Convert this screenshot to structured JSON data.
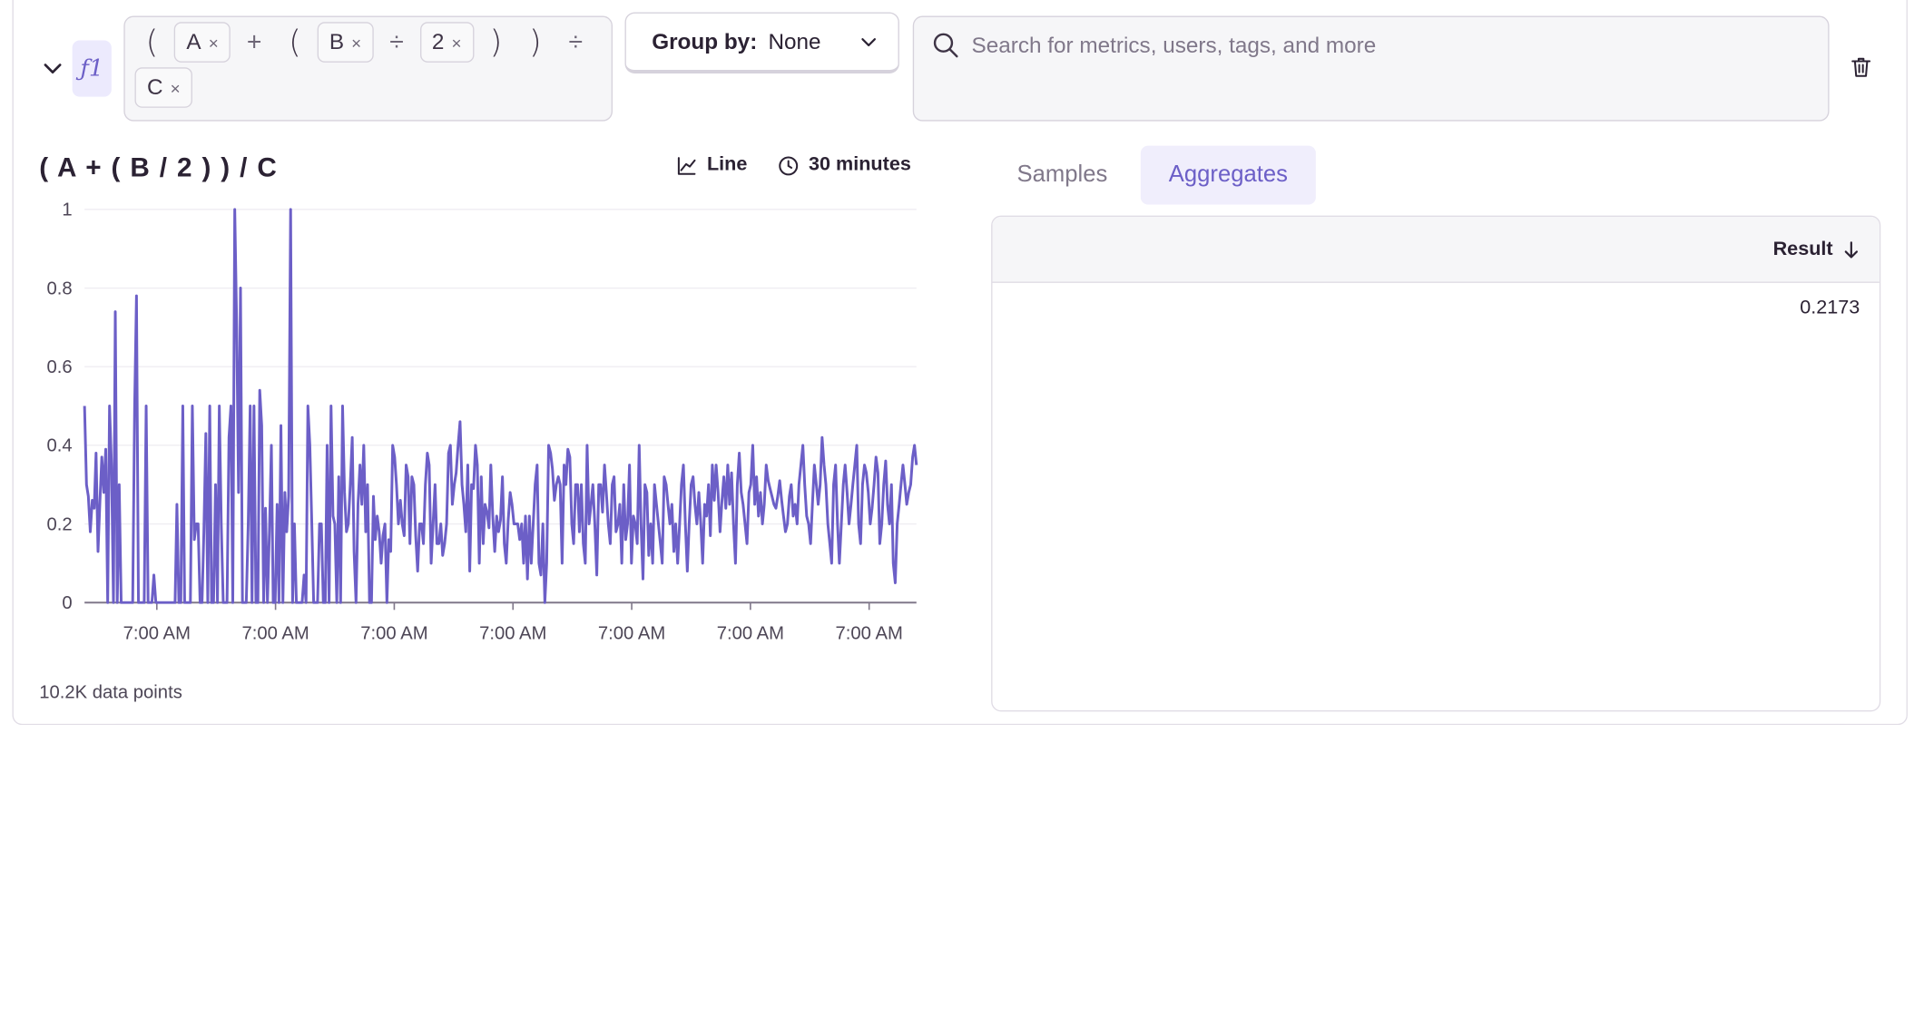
{
  "formula": {
    "label": "ƒ1",
    "tokens": [
      {
        "kind": "paren",
        "text": "("
      },
      {
        "kind": "pill",
        "text": "A"
      },
      {
        "kind": "op",
        "text": "+"
      },
      {
        "kind": "paren",
        "text": "("
      },
      {
        "kind": "pill",
        "text": "B"
      },
      {
        "kind": "op",
        "text": "÷"
      },
      {
        "kind": "pill",
        "text": "2"
      },
      {
        "kind": "paren",
        "text": ")"
      },
      {
        "kind": "paren",
        "text": ")"
      },
      {
        "kind": "op",
        "text": "÷"
      },
      {
        "kind": "pill",
        "text": "C"
      }
    ],
    "remove_glyph": "×"
  },
  "group_by": {
    "label": "Group by:",
    "value": "None"
  },
  "search": {
    "placeholder": "Search for metrics, users, tags, and more"
  },
  "widget": {
    "title": "( A + ( B / 2 ) ) / C",
    "display_type": "Line",
    "interval": "30 minutes",
    "footer": "10.2K data points"
  },
  "tabs": [
    "Samples",
    "Aggregates"
  ],
  "active_tab": "Aggregates",
  "results": {
    "column": "Result",
    "rows": [
      "0.2173"
    ]
  },
  "icons": {
    "collapse": "chevron-down-icon",
    "group_by_dropdown": "chevron-down-icon",
    "search": "search-icon",
    "delete": "trash-icon",
    "line": "line-chart-icon",
    "interval": "clock-icon",
    "sort": "arrow-down-icon"
  },
  "colors": {
    "series": "#6c5fc7",
    "accent": "#6c5fc7"
  },
  "chart_data": {
    "type": "line",
    "title": "( A + ( B / 2 ) ) / C",
    "ylim": [
      0,
      1
    ],
    "yticks": [
      "0",
      "0.2",
      "0.4",
      "0.6",
      "0.8",
      "1"
    ],
    "xticks": [
      "7:00 AM",
      "7:00 AM",
      "7:00 AM",
      "7:00 AM",
      "7:00 AM",
      "7:00 AM",
      "7:00 AM"
    ],
    "grid": true,
    "series": [
      {
        "values": [
          0.5,
          0.3,
          0.27,
          0.18,
          0.26,
          0.24,
          0.38,
          0.13,
          0.26,
          0.37,
          0.28,
          0.39,
          0.0,
          0.5,
          0.35,
          0.0,
          0.74,
          0.0,
          0.3,
          0.0,
          0.0,
          0.0,
          0.0,
          0.0,
          0.0,
          0.0,
          0.5,
          0.78,
          0.0,
          0.0,
          0.0,
          0.0,
          0.5,
          0.0,
          0.0,
          0.0,
          0.07,
          0.0,
          0.0,
          0.0,
          0.0,
          0.0,
          0.0,
          0.0,
          0.0,
          0.0,
          0.0,
          0.0,
          0.25,
          0.0,
          0.0,
          0.5,
          0.0,
          0.0,
          0.0,
          0.0,
          0.5,
          0.16,
          0.2,
          0.2,
          0.0,
          0.0,
          0.18,
          0.43,
          0.0,
          0.5,
          0.0,
          0.0,
          0.3,
          0.0,
          0.5,
          0.2,
          0.0,
          0.0,
          0.0,
          0.42,
          0.5,
          0.0,
          1.0,
          0.7,
          0.28,
          0.8,
          0.0,
          0.0,
          0.0,
          0.2,
          0.5,
          0.0,
          0.5,
          0.0,
          0.0,
          0.54,
          0.45,
          0.0,
          0.24,
          0.0,
          0.18,
          0.4,
          0.0,
          0.0,
          0.25,
          0.0,
          0.45,
          0.0,
          0.28,
          0.18,
          0.27,
          1.0,
          0.0,
          0.2,
          0.0,
          0.0,
          0.0,
          0.0,
          0.07,
          0.0,
          0.5,
          0.4,
          0.2,
          0.0,
          0.0,
          0.0,
          0.2,
          0.2,
          0.0,
          0.0,
          0.4,
          0.0,
          0.5,
          0.22,
          0.2,
          0.0,
          0.32,
          0.0,
          0.5,
          0.28,
          0.18,
          0.2,
          0.3,
          0.42,
          0.13,
          0.0,
          0.25,
          0.35,
          0.25,
          0.4,
          0.18,
          0.3,
          0.0,
          0.0,
          0.27,
          0.16,
          0.22,
          0.18,
          0.1,
          0.17,
          0.2,
          0.0,
          0.16,
          0.13,
          0.4,
          0.37,
          0.3,
          0.2,
          0.26,
          0.2,
          0.17,
          0.35,
          0.32,
          0.15,
          0.32,
          0.3,
          0.17,
          0.08,
          0.2,
          0.2,
          0.15,
          0.3,
          0.38,
          0.35,
          0.1,
          0.2,
          0.3,
          0.15,
          0.15,
          0.2,
          0.12,
          0.15,
          0.2,
          0.38,
          0.4,
          0.25,
          0.3,
          0.33,
          0.4,
          0.46,
          0.3,
          0.25,
          0.18,
          0.35,
          0.08,
          0.3,
          0.29,
          0.4,
          0.35,
          0.1,
          0.32,
          0.15,
          0.25,
          0.23,
          0.19,
          0.35,
          0.22,
          0.13,
          0.22,
          0.18,
          0.21,
          0.32,
          0.15,
          0.1,
          0.21,
          0.28,
          0.25,
          0.2,
          0.2,
          0.2,
          0.16,
          0.2,
          0.1,
          0.22,
          0.06,
          0.22,
          0.1,
          0.2,
          0.3,
          0.35,
          0.1,
          0.07,
          0.2,
          0.0,
          0.1,
          0.4,
          0.38,
          0.34,
          0.26,
          0.3,
          0.32,
          0.3,
          0.1,
          0.35,
          0.3,
          0.39,
          0.37,
          0.2,
          0.15,
          0.3,
          0.3,
          0.18,
          0.3,
          0.15,
          0.1,
          0.4,
          0.2,
          0.25,
          0.3,
          0.2,
          0.07,
          0.3,
          0.3,
          0.23,
          0.35,
          0.28,
          0.2,
          0.15,
          0.3,
          0.32,
          0.18,
          0.2,
          0.25,
          0.1,
          0.3,
          0.16,
          0.2,
          0.35,
          0.1,
          0.22,
          0.2,
          0.15,
          0.4,
          0.2,
          0.06,
          0.3,
          0.28,
          0.12,
          0.2,
          0.1,
          0.3,
          0.25,
          0.2,
          0.15,
          0.1,
          0.32,
          0.3,
          0.25,
          0.2,
          0.25,
          0.13,
          0.2,
          0.1,
          0.2,
          0.3,
          0.35,
          0.2,
          0.08,
          0.2,
          0.3,
          0.32,
          0.25,
          0.2,
          0.28,
          0.2,
          0.1,
          0.25,
          0.22,
          0.3,
          0.17,
          0.35,
          0.26,
          0.35,
          0.28,
          0.18,
          0.26,
          0.32,
          0.24,
          0.35,
          0.25,
          0.33,
          0.2,
          0.1,
          0.3,
          0.38,
          0.28,
          0.25,
          0.2,
          0.15,
          0.28,
          0.3,
          0.4,
          0.25,
          0.32,
          0.22,
          0.28,
          0.2,
          0.25,
          0.35,
          0.31,
          0.29,
          0.27,
          0.25,
          0.24,
          0.27,
          0.31,
          0.26,
          0.22,
          0.18,
          0.2,
          0.27,
          0.3,
          0.22,
          0.25,
          0.2,
          0.3,
          0.35,
          0.4,
          0.3,
          0.22,
          0.2,
          0.15,
          0.25,
          0.35,
          0.3,
          0.25,
          0.3,
          0.42,
          0.35,
          0.3,
          0.2,
          0.15,
          0.1,
          0.3,
          0.35,
          0.2,
          0.1,
          0.2,
          0.3,
          0.35,
          0.28,
          0.2,
          0.25,
          0.3,
          0.35,
          0.4,
          0.2,
          0.15,
          0.3,
          0.35,
          0.33,
          0.28,
          0.2,
          0.24,
          0.3,
          0.37,
          0.33,
          0.15,
          0.2,
          0.3,
          0.36,
          0.25,
          0.2,
          0.3,
          0.1,
          0.05,
          0.2,
          0.25,
          0.3,
          0.35,
          0.3,
          0.25,
          0.28,
          0.3,
          0.37,
          0.4,
          0.35
        ]
      }
    ]
  }
}
